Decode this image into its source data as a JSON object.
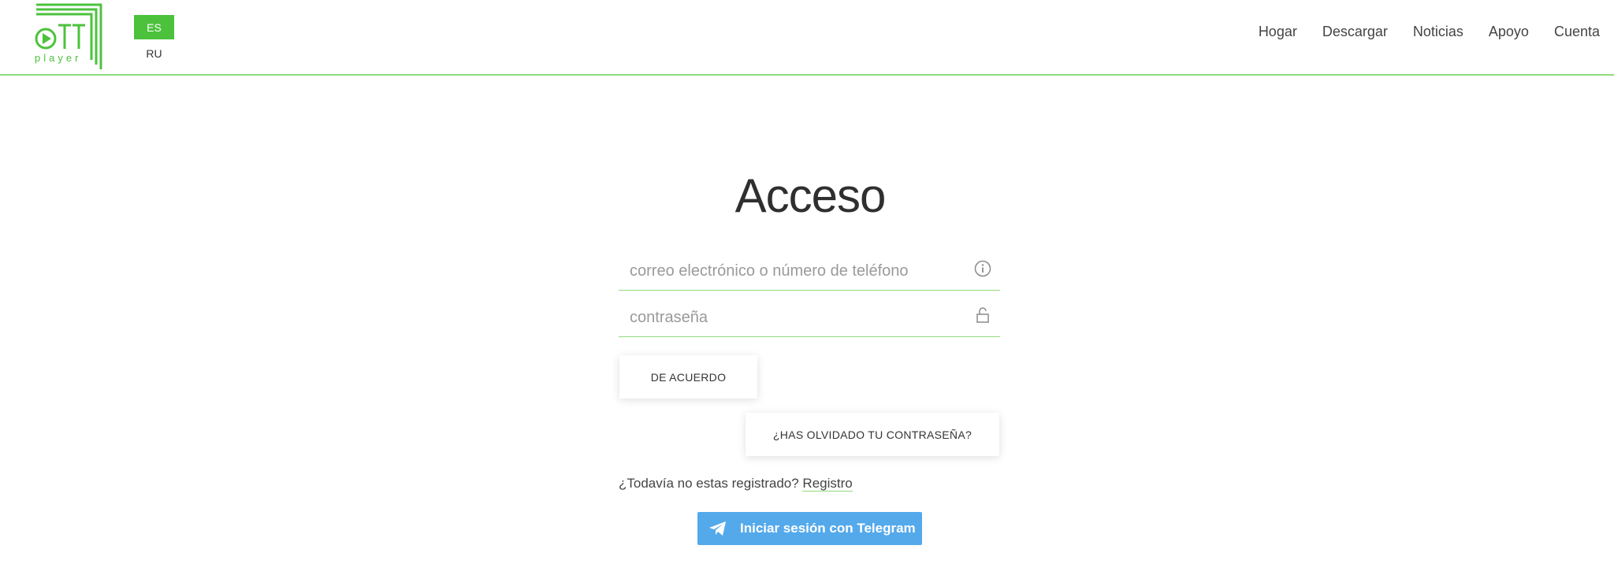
{
  "header": {
    "logo": {
      "text": "OTT",
      "subtext": "player",
      "icon": "play-icon"
    },
    "languages": [
      {
        "label": "ES",
        "active": true
      },
      {
        "label": "RU",
        "active": false
      }
    ],
    "nav": [
      {
        "label": "Hogar"
      },
      {
        "label": "Descargar"
      },
      {
        "label": "Noticias"
      },
      {
        "label": "Apoyo"
      },
      {
        "label": "Cuenta"
      }
    ]
  },
  "login": {
    "title": "Acceso",
    "email": {
      "value": "",
      "placeholder": "correo electrónico o número de teléfono",
      "icon": "info-icon"
    },
    "password": {
      "value": "",
      "placeholder": "contraseña",
      "icon": "unlock-icon"
    },
    "submit_label": "DE ACUERDO",
    "forgot_label": "¿HAS OLVIDADO TU CONTRASEÑA?",
    "register_prompt": "¿Todavía no estas registrado?",
    "register_link": "Registro",
    "telegram_label": "Iniciar sesión con Telegram",
    "telegram_icon": "telegram-icon"
  },
  "colors": {
    "accent_green": "#4cc23c",
    "divider_green": "#8fdb7a",
    "telegram_blue": "#54a9eb"
  }
}
